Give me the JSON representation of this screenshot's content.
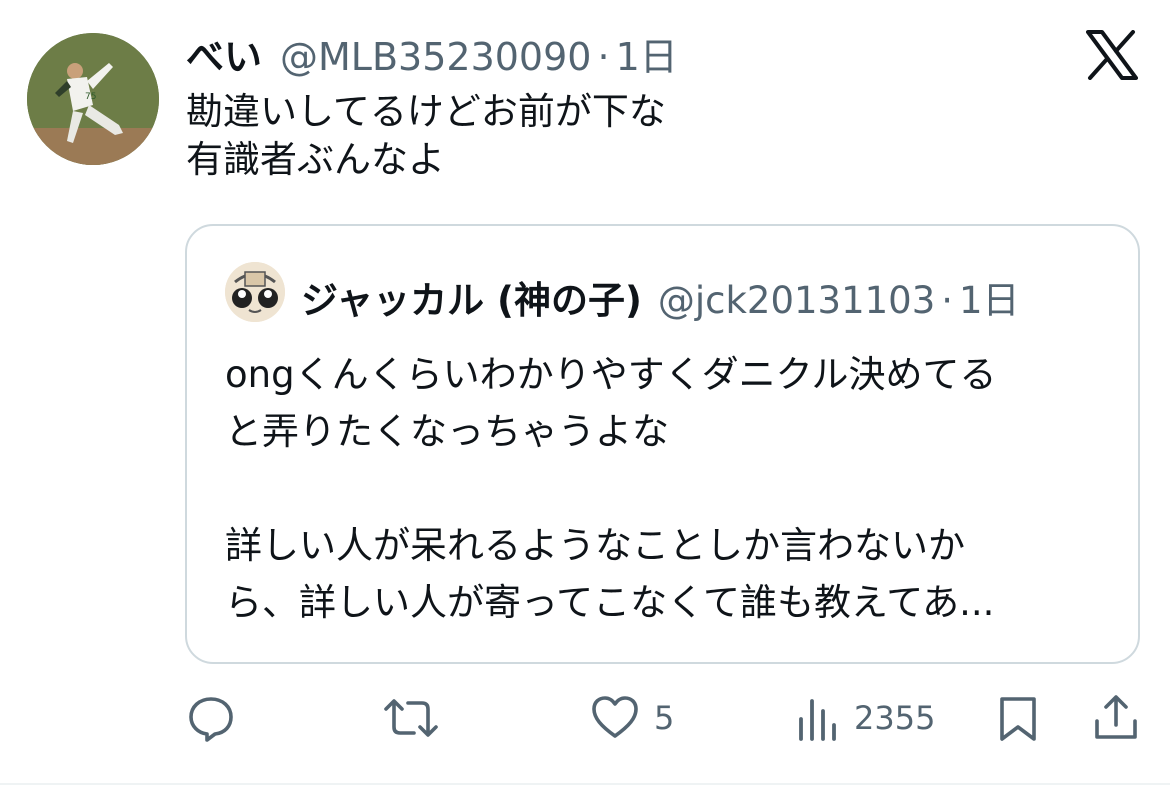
{
  "tweet": {
    "display_name": "べい",
    "handle": "@MLB35230090",
    "separator": "·",
    "time": "1日",
    "lines": [
      "勘違いしてるけどお前が下な",
      "有識者ぶんなよ"
    ]
  },
  "quote": {
    "display_name": "ジャッカル (神の子)",
    "handle": "@jck20131103",
    "separator": "·",
    "time": "1日",
    "paragraph_1": [
      "ongくんくらいわかりやすくダニクル決めてる",
      "と弄りたくなっちゃうよな"
    ],
    "paragraph_2": [
      "詳しい人が呆れるようなことしか言わないか",
      "ら、詳しい人が寄ってこなくて誰も教えてあ..."
    ]
  },
  "actions": {
    "reply_icon": "reply-icon",
    "retweet_icon": "retweet-icon",
    "like_icon": "heart-icon",
    "like_count": "5",
    "views_icon": "views-icon",
    "views_count": "2355",
    "bookmark_icon": "bookmark-icon",
    "share_icon": "share-icon"
  },
  "colors": {
    "text": "#0f1419",
    "secondary": "#536471",
    "border": "#cfd9de",
    "background": "#ffffff"
  }
}
